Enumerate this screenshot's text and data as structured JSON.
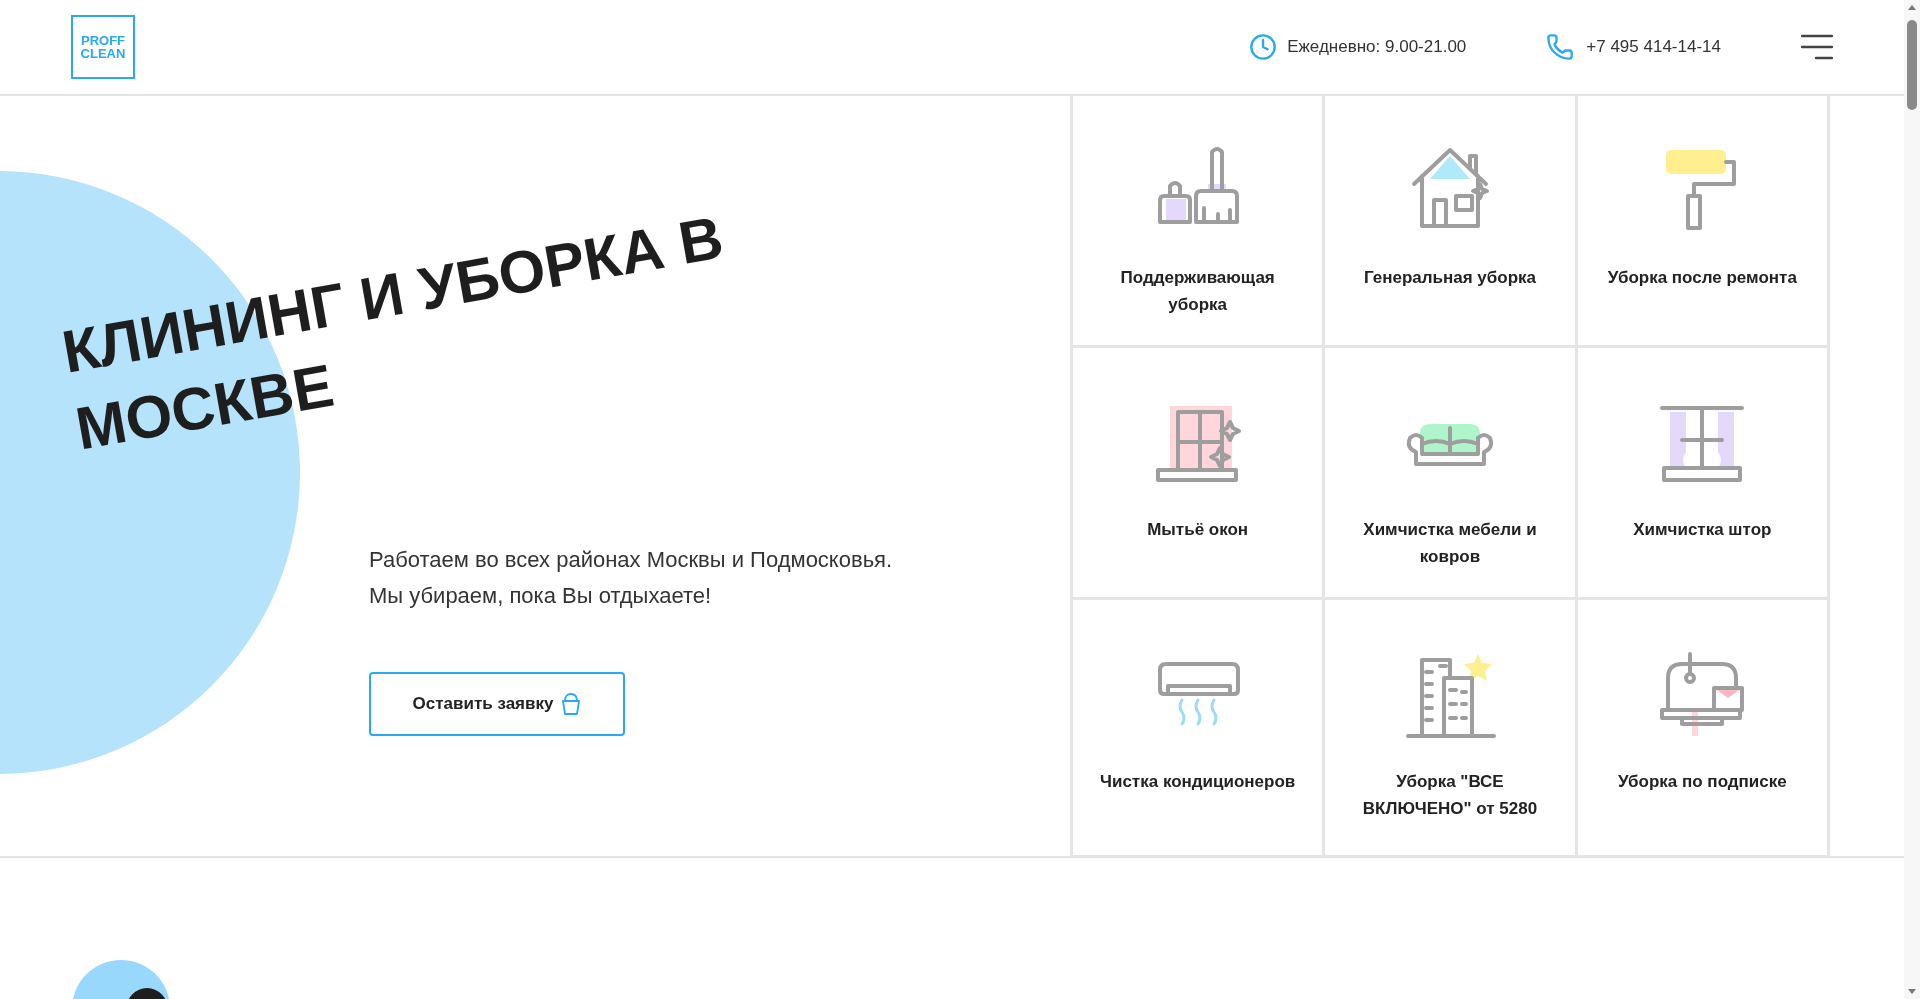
{
  "header": {
    "logo": [
      "PROFF",
      "CLEAN"
    ],
    "hours": "Ежедневно: 9.00-21.00",
    "phone": "+7 495 414-14-14"
  },
  "hero": {
    "title": "КЛИНИНГ И УБОРКА В МОСКВЕ",
    "text": "Работаем во всех районах Москвы и Подмосковья. Мы убираем, пока Вы отдыхаете!",
    "button": "Оставить заявку"
  },
  "services": [
    {
      "label": "Поддерживающая уборка"
    },
    {
      "label": "Генеральная уборка"
    },
    {
      "label": "Уборка после ремонта"
    },
    {
      "label": "Мытьё окон"
    },
    {
      "label": "Химчистка мебели и ковров"
    },
    {
      "label": "Химчистка штор"
    },
    {
      "label": "Чистка кондиционеров"
    },
    {
      "label": "Уборка \"ВСЕ ВКЛЮЧЕНО\" от 5280"
    },
    {
      "label": "Уборка по подписке"
    }
  ]
}
